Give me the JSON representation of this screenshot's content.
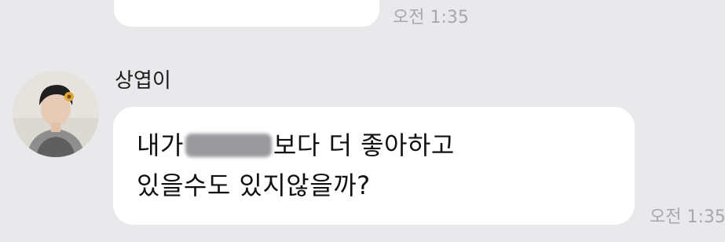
{
  "previous_message": {
    "time": "오전 1:35"
  },
  "message": {
    "sender": "상엽이",
    "line1_before": "내가",
    "line1_after": "보다 더 좋아하고",
    "line2": "있을수도 있지않을까?",
    "time": "오전 1:35"
  },
  "colors": {
    "background": "#e9e9eb",
    "bubble": "#ffffff",
    "timestamp": "#a8a8ab",
    "text": "#111111"
  }
}
